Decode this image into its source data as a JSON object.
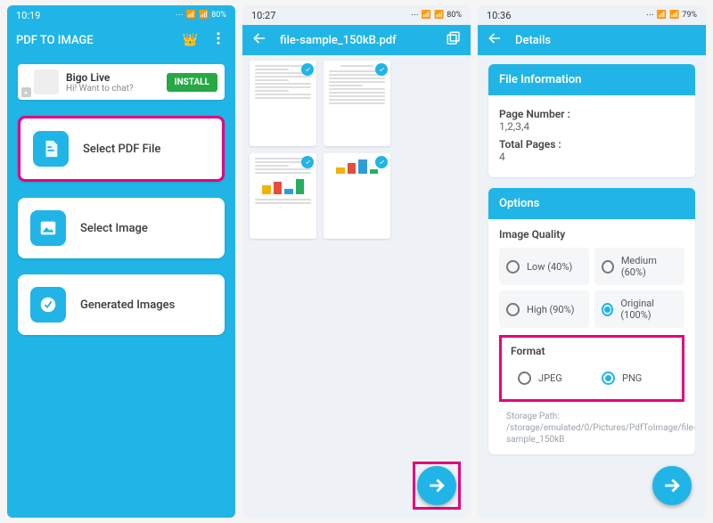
{
  "screen1": {
    "status": {
      "time": "10:19",
      "battery": "80%"
    },
    "appbar": {
      "title": "PDF TO IMAGE"
    },
    "ad": {
      "title": "Bigo Live",
      "subtitle": "Hi! Want to chat?",
      "button": "INSTALL"
    },
    "cards": [
      {
        "label": "Select PDF File"
      },
      {
        "label": "Select Image"
      },
      {
        "label": "Generated Images"
      }
    ]
  },
  "screen2": {
    "status": {
      "time": "10:27",
      "battery": "80%"
    },
    "appbar": {
      "filename": "file-sample_150kB.pdf"
    }
  },
  "screen3": {
    "status": {
      "time": "10:36",
      "battery": "79%"
    },
    "appbar": {
      "title": "Details"
    },
    "fileinfo": {
      "title": "File Information",
      "page_number_label": "Page Number :",
      "page_number_value": "1,2,3,4",
      "total_pages_label": "Total Pages :",
      "total_pages_value": "4"
    },
    "options": {
      "title": "Options",
      "quality_label": "Image Quality",
      "quality": [
        {
          "label": "Low (40%)",
          "selected": false
        },
        {
          "label": "Medium (60%)",
          "selected": false
        },
        {
          "label": "High (90%)",
          "selected": false
        },
        {
          "label": "Original (100%)",
          "selected": true
        }
      ],
      "format_label": "Format",
      "format": [
        {
          "label": "JPEG",
          "selected": false
        },
        {
          "label": "PNG",
          "selected": true
        }
      ],
      "storage_label": "Storage Path: /storage/emulated/0/Pictures/PdfToImage/file-sample_150kB"
    }
  }
}
